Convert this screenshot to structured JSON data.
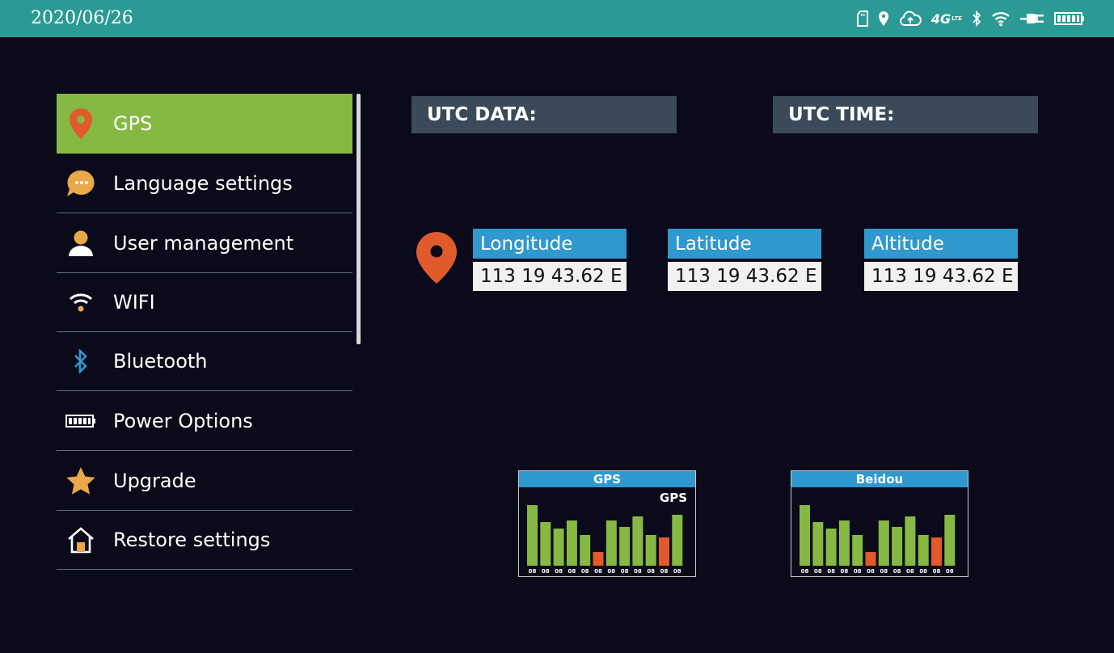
{
  "status_bar": {
    "date": "2020/06/26",
    "lte_label": "4G",
    "lte_sub": "LTE",
    "icons": [
      "sd-card-icon",
      "location-icon",
      "cloud-upload-icon",
      "lte-icon",
      "bluetooth-icon",
      "wifi-icon",
      "plug-icon",
      "battery-icon"
    ]
  },
  "sidebar": {
    "items": [
      {
        "label": "GPS",
        "icon": "location-pin-icon",
        "active": true
      },
      {
        "label": "Language settings",
        "icon": "chat-bubble-icon"
      },
      {
        "label": "User management",
        "icon": "user-icon"
      },
      {
        "label": "WIFI",
        "icon": "wifi-icon"
      },
      {
        "label": "Bluetooth",
        "icon": "bluetooth-icon"
      },
      {
        "label": "Power Options",
        "icon": "battery-icon"
      },
      {
        "label": "Upgrade",
        "icon": "star-icon"
      },
      {
        "label": "Restore settings",
        "icon": "home-icon"
      }
    ]
  },
  "utc": {
    "date_label": "UTC DATA:",
    "time_label": "UTC TIME:"
  },
  "coords": {
    "longitude": {
      "label": "Longitude",
      "value": "113 19 43.62 E"
    },
    "latitude": {
      "label": "Latitude",
      "value": "113 19 43.62 E"
    },
    "altitude": {
      "label": "Altitude",
      "value": "113 19 43.62 E"
    }
  },
  "charts": {
    "gps": {
      "title": "GPS",
      "subtitle": "GPS",
      "labels": [
        "08",
        "08",
        "08",
        "08",
        "08",
        "08",
        "08",
        "08",
        "08",
        "08",
        "08",
        "08"
      ],
      "values": [
        75,
        54,
        46,
        56,
        38,
        17,
        56,
        48,
        61,
        38,
        35,
        63
      ],
      "highlight": [
        false,
        false,
        false,
        false,
        false,
        true,
        false,
        false,
        false,
        false,
        true,
        false
      ]
    },
    "beidou": {
      "title": "Beidou",
      "labels": [
        "08",
        "08",
        "08",
        "08",
        "08",
        "08",
        "08",
        "08",
        "08",
        "08",
        "08",
        "08"
      ],
      "values": [
        75,
        54,
        46,
        56,
        38,
        17,
        56,
        48,
        61,
        38,
        35,
        63
      ],
      "highlight": [
        false,
        false,
        false,
        false,
        false,
        true,
        false,
        false,
        false,
        false,
        true,
        false
      ]
    }
  },
  "colors": {
    "status_bar": "#2b9a94",
    "active_menu": "#86b943",
    "accent_blue": "#2f98cf",
    "bar_green": "#86b943",
    "bar_red": "#e05a2b",
    "pin_orange": "#e05a2b"
  }
}
